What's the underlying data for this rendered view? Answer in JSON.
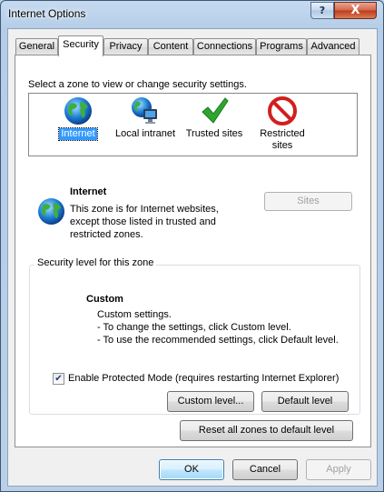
{
  "window": {
    "title": "Internet Options",
    "help_label": "?",
    "close_label": "X"
  },
  "tabs": [
    {
      "label": "General",
      "active": false
    },
    {
      "label": "Security",
      "active": true
    },
    {
      "label": "Privacy",
      "active": false
    },
    {
      "label": "Content",
      "active": false
    },
    {
      "label": "Connections",
      "active": false
    },
    {
      "label": "Programs",
      "active": false
    },
    {
      "label": "Advanced",
      "active": false
    }
  ],
  "security": {
    "select_zone_prompt": "Select a zone to view or change security settings.",
    "zones": [
      {
        "label": "Internet",
        "icon": "globe-icon",
        "selected": true
      },
      {
        "label": "Local intranet",
        "icon": "intranet-icon",
        "selected": false
      },
      {
        "label": "Trusted sites",
        "icon": "checkmark-icon",
        "selected": false
      },
      {
        "label_line1": "Restricted",
        "label_line2": "sites",
        "icon": "restricted-icon",
        "selected": false
      }
    ],
    "zone_info": {
      "title": "Internet",
      "desc_line1": "This zone is for Internet websites,",
      "desc_line2": "except those listed in trusted and",
      "desc_line3": "restricted zones.",
      "sites_button": "Sites"
    },
    "level_group": {
      "title": "Security level for this zone",
      "level_name": "Custom",
      "line1": "Custom settings.",
      "line2": "- To change the settings, click Custom level.",
      "line3": "- To use the recommended settings, click Default level."
    },
    "protected_mode": {
      "label": "Enable Protected Mode (requires restarting Internet Explorer)",
      "checked": true,
      "check_glyph": "✔"
    },
    "custom_level_button": "Custom level...",
    "default_level_button": "Default level",
    "reset_all_button": "Reset all zones to default level"
  },
  "dialog_buttons": {
    "ok": "OK",
    "cancel": "Cancel",
    "apply": "Apply"
  },
  "colors": {
    "selection": "#3399ff",
    "close_button": "#c0381a",
    "title_bar": "#b5cde7"
  }
}
